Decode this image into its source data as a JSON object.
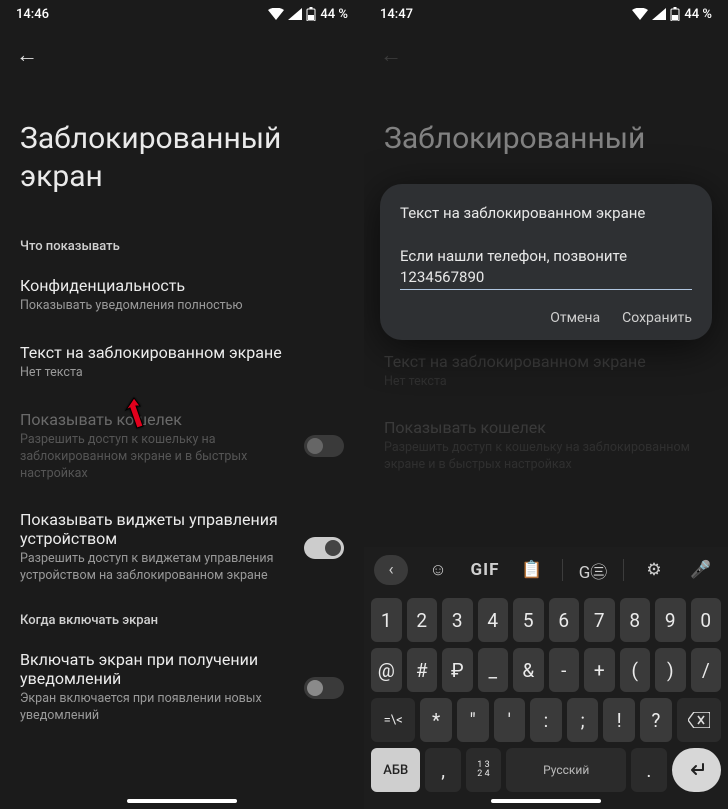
{
  "left": {
    "status": {
      "time": "14:46",
      "battery_text": "44 %"
    },
    "title": "Заблокированный экран",
    "section_show": "Что показывать",
    "items": [
      {
        "title": "Конфиденциальность",
        "sub": "Показывать уведомления полностью"
      },
      {
        "title": "Текст на заблокированном экране",
        "sub": "Нет текста"
      },
      {
        "title": "Показывать кошелек",
        "sub": "Разрешить доступ к кошельку на заблокированном экране и в быстрых настройках"
      },
      {
        "title": "Показывать виджеты управления устройством",
        "sub": "Разрешить доступ к виджетам управления устройством на заблокированном экране"
      }
    ],
    "section_when": "Когда включать экран",
    "wake": {
      "title": "Включать экран при получении уведомлений",
      "sub": "Экран включается при появлении новых уведомлений"
    }
  },
  "right": {
    "status": {
      "time": "14:47",
      "battery_text": "44 %"
    },
    "title": "Заблокированный",
    "dialog": {
      "title": "Текст на заблокированном экране",
      "value": "Если нашли телефон, позвоните 1234567890",
      "cancel": "Отмена",
      "save": "Сохранить"
    },
    "items": [
      {
        "title": "Текст на заблокированном экране",
        "sub": "Нет текста"
      },
      {
        "title": "Показывать кошелек",
        "sub": "Разрешить доступ к кошельку на заблокированном экране и в быстрых настройках"
      }
    ],
    "keyboard": {
      "gif": "GIF",
      "row1": [
        "1",
        "2",
        "3",
        "4",
        "5",
        "6",
        "7",
        "8",
        "9",
        "0"
      ],
      "row2": [
        "@",
        "#",
        "₽",
        "_",
        "&",
        "-",
        "+",
        "(",
        ")",
        "/"
      ],
      "row2_sup": [
        "",
        "",
        "",
        "",
        "",
        "",
        "",
        "",
        "",
        ""
      ],
      "row3_shift": "=\\<",
      "row3": [
        "*",
        "\"",
        "'",
        ":",
        ";",
        "!",
        "?"
      ],
      "abc": "АБВ",
      "comma": ",",
      "row4_subs": [
        "1",
        "2",
        "1\n2",
        "3\n4"
      ],
      "space_label": "Русский",
      "period": "."
    }
  }
}
